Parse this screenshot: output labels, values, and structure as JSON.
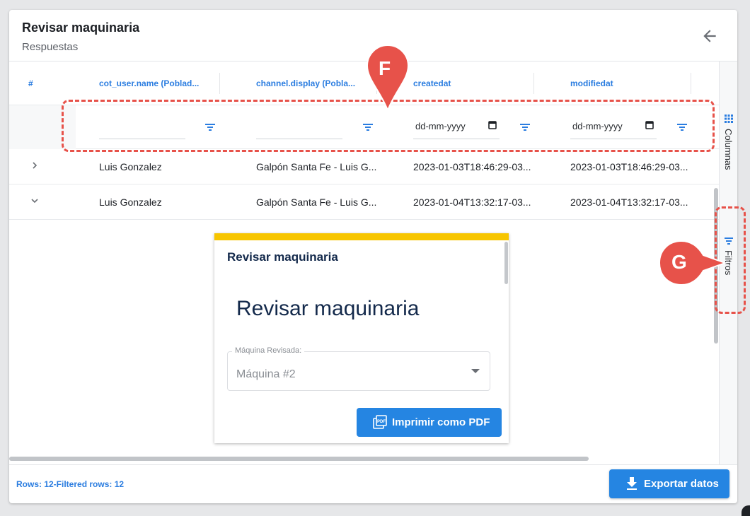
{
  "header": {
    "title": "Revisar maquinaria",
    "subtitle": "Respuestas"
  },
  "columns": [
    {
      "label": "#"
    },
    {
      "label": "cot_user.name (Poblad..."
    },
    {
      "label": "channel.display (Pobla..."
    },
    {
      "label": "createdat"
    },
    {
      "label": "modifiedat"
    }
  ],
  "filters": {
    "createdat_placeholder": "dd-mm-yyyy",
    "modifiedat_placeholder": "dd-mm-yyyy"
  },
  "rows": [
    {
      "user": "Luis Gonzalez",
      "channel": "Galpón Santa Fe - Luis G...",
      "createdat": "2023-01-03T18:46:29-03...",
      "modifiedat": "2023-01-03T18:46:29-03..."
    },
    {
      "user": "Luis Gonzalez",
      "channel": "Galpón Santa Fe - Luis G...",
      "createdat": "2023-01-04T13:32:17-03...",
      "modifiedat": "2023-01-04T13:32:17-03..."
    }
  ],
  "detail": {
    "card_title": "Revisar maquinaria",
    "heading": "Revisar maquinaria",
    "field_label": "Máquina Revisada:",
    "field_value": "Máquina #2",
    "pdf_button": "Imprimir como PDF",
    "pdf_icon_text": "PDF"
  },
  "side_panel": {
    "columns_label": "Columnas",
    "filters_label": "Filtros"
  },
  "footer": {
    "rows_info": "Rows: 12-Filtered rows: 12",
    "export_button": "Exportar datos"
  },
  "annotations": {
    "marker_f": "F",
    "marker_g": "G",
    "color": "#e7524a"
  },
  "colors": {
    "accent": "#2585e2",
    "header_text": "#2b7de0",
    "card_stripe": "#f7c500",
    "title_text": "#13294b"
  }
}
